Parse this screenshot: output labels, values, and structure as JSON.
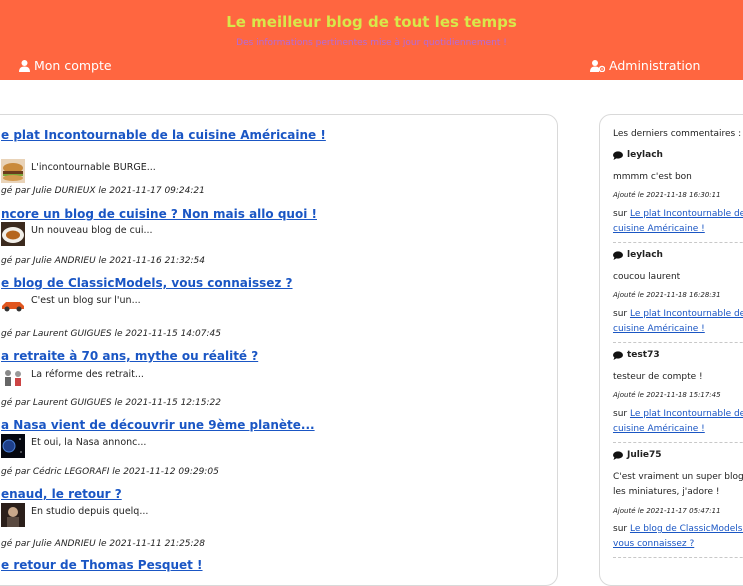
{
  "header": {
    "title": "Le meilleur blog de tout les temps",
    "subtitle": "Des informations pertinentes mise à jour quotidiennement !",
    "nav_account": "Mon compte",
    "nav_admin": "Administration"
  },
  "colors": {
    "header_bg": "#ff6640",
    "title": "#d8e84a",
    "subtitle": "#b46ad8",
    "link": "#1a56c4"
  },
  "posts": [
    {
      "title": "e plat Incontournable de la cuisine Américaine !",
      "excerpt": "L'incontournable BURGE...",
      "meta": "gé par Julie DURIEUX le 2021-11-17 09:24:21"
    },
    {
      "title": "ncore un blog de cuisine ? Non mais allo quoi !",
      "excerpt": "Un nouveau blog de cui...",
      "meta": "gé par Julie ANDRIEU le 2021-11-16 21:32:54"
    },
    {
      "title": "e blog de ClassicModels, vous connaissez ?",
      "excerpt": "C'est un blog sur l'un...",
      "meta": "gé par Laurent GUIGUES le 2021-11-15 14:07:45"
    },
    {
      "title": "a retraite à 70 ans, mythe ou réalité ?",
      "excerpt": "La réforme des retrait...",
      "meta": "gé par Laurent GUIGUES le 2021-11-15 12:15:22"
    },
    {
      "title": "a Nasa vient de découvrir une 9ème planète...",
      "excerpt": "Et oui, la Nasa annonc...",
      "meta": "gé par Cédric LEGORAFI le 2021-11-12 09:29:05"
    },
    {
      "title": "enaud, le retour ?",
      "excerpt": "En studio depuis quelq...",
      "meta": "gé par Julie ANDRIEU le 2021-11-11 21:25:28"
    },
    {
      "title": "e retour de Thomas Pesquet !",
      "excerpt": "",
      "meta": ""
    }
  ],
  "comments_heading": "Les derniers commentaires :",
  "comments": [
    {
      "user": "leylach",
      "text": "mmmm c'est bon",
      "date": "Ajouté le 2021-11-18 16:30:11",
      "on": "sur",
      "link": "Le plat Incontournable de la cuisine Américaine !"
    },
    {
      "user": "leylach",
      "text": "coucou laurent",
      "date": "Ajouté le 2021-11-18 16:28:31",
      "on": "sur",
      "link": "Le plat Incontournable de la cuisine Américaine !"
    },
    {
      "user": "test73",
      "text": "testeur de compte !",
      "date": "Ajouté le 2021-11-18 15:17:45",
      "on": "sur",
      "link": "Le plat Incontournable de la cuisine Américaine !"
    },
    {
      "user": "Julie75",
      "text": "C'est vraiment un super blog sur les miniatures, j'adore !",
      "date": "Ajouté le 2021-11-17 05:47:11",
      "on": "sur",
      "link": "Le blog de ClassicModels, vous connaissez ?"
    }
  ]
}
